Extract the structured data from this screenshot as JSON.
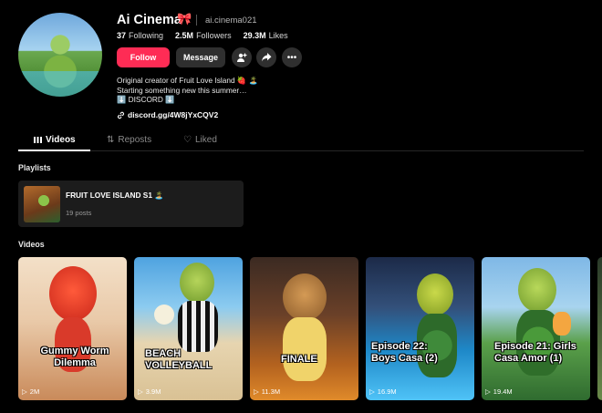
{
  "profile": {
    "name": "Ai Cinema",
    "name_badge": "🎀",
    "handle": "ai.cinema021",
    "stats": {
      "following_count": "37",
      "following_label": "Following",
      "followers_count": "2.5M",
      "followers_label": "Followers",
      "likes_count": "29.3M",
      "likes_label": "Likes"
    },
    "buttons": {
      "follow": "Follow",
      "message": "Message",
      "add_friend_icon": "add-user-icon",
      "share_icon": "share-icon",
      "more_icon": "more-icon"
    },
    "bio": [
      "Original creator of Fruit Love Island 🍓 🏝️",
      "Starting something new this summer…",
      "⬇️ DISCORD ⬇️"
    ],
    "link": "discord.gg/4W8jYxCQV2"
  },
  "tabs": [
    {
      "label": "Videos",
      "icon": "grid-icon",
      "active": true
    },
    {
      "label": "Reposts",
      "icon": "repost-icon",
      "active": false
    },
    {
      "label": "Liked",
      "icon": "heart-icon",
      "active": false
    }
  ],
  "playlists": {
    "title": "Playlists",
    "items": [
      {
        "title": "FRUIT LOVE ISLAND S1 🏝️",
        "count": "19 posts"
      }
    ]
  },
  "videos": {
    "title": "Videos",
    "items": [
      {
        "caption": "Gummy Worm Dilemma",
        "views": "2M"
      },
      {
        "caption": "BEACH VOLLEYBALL",
        "views": "3.9M"
      },
      {
        "caption": "FINALE",
        "views": "11.3M"
      },
      {
        "caption": "Episode 22: Boys Casa (2)",
        "views": "16.9M"
      },
      {
        "caption": "Episode 21: Girls Casa Amor (1)",
        "views": "19.4M"
      }
    ]
  },
  "colors": {
    "background": "#000000",
    "follow_button": "#fe2c55",
    "secondary_button": "#2f2f2f",
    "muted_text": "#8a8a8a"
  }
}
